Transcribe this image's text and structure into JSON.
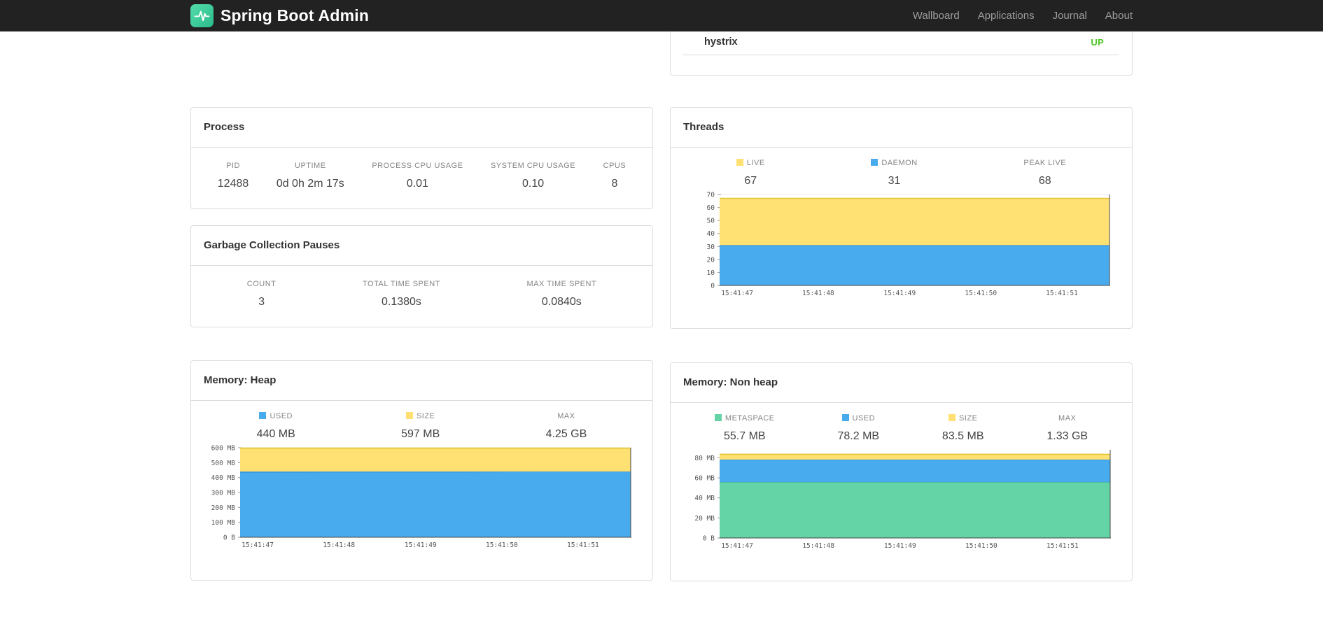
{
  "navbar": {
    "brand": "Spring Boot Admin",
    "links": [
      {
        "label": "Wallboard"
      },
      {
        "label": "Applications"
      },
      {
        "label": "Journal"
      },
      {
        "label": "About"
      }
    ]
  },
  "colors": {
    "status_up": "#46c41c",
    "blue": "#48abee",
    "blue_edge": "#2f8fd4",
    "yellow": "#ffe173",
    "yellow_edge": "#e2c338",
    "green": "#64d3a5",
    "green_edge": "#3fbd8a"
  },
  "health": {
    "service": "hystrix",
    "status": "UP"
  },
  "process": {
    "title": "Process",
    "metrics": [
      {
        "label": "PID",
        "value": "12488"
      },
      {
        "label": "UPTIME",
        "value": "0d 0h 2m 17s"
      },
      {
        "label": "PROCESS CPU USAGE",
        "value": "0.01"
      },
      {
        "label": "SYSTEM CPU USAGE",
        "value": "0.10"
      },
      {
        "label": "CPUS",
        "value": "8"
      }
    ]
  },
  "gc": {
    "title": "Garbage Collection Pauses",
    "metrics": [
      {
        "label": "COUNT",
        "value": "3"
      },
      {
        "label": "TOTAL TIME SPENT",
        "value": "0.1380s"
      },
      {
        "label": "MAX TIME SPENT",
        "value": "0.0840s"
      }
    ]
  },
  "threads": {
    "title": "Threads",
    "legend": [
      {
        "label": "LIVE",
        "value": "67",
        "color": "#ffe173"
      },
      {
        "label": "DAEMON",
        "value": "31",
        "color": "#48abee"
      },
      {
        "label": "PEAK LIVE",
        "value": "68"
      }
    ]
  },
  "heap": {
    "title": "Memory: Heap",
    "legend": [
      {
        "label": "USED",
        "value": "440 MB",
        "color": "#48abee"
      },
      {
        "label": "SIZE",
        "value": "597 MB",
        "color": "#ffe173"
      },
      {
        "label": "MAX",
        "value": "4.25 GB"
      }
    ]
  },
  "nonheap": {
    "title": "Memory: Non heap",
    "legend": [
      {
        "label": "METASPACE",
        "value": "55.7 MB",
        "color": "#64d3a5"
      },
      {
        "label": "USED",
        "value": "78.2 MB",
        "color": "#48abee"
      },
      {
        "label": "SIZE",
        "value": "83.5 MB",
        "color": "#ffe173"
      },
      {
        "label": "MAX",
        "value": "1.33 GB"
      }
    ]
  },
  "chart_data": [
    {
      "id": "threads",
      "type": "area",
      "stacked": true,
      "title": "Threads",
      "x": [
        "15:41:47",
        "15:41:48",
        "15:41:49",
        "15:41:50",
        "15:41:51"
      ],
      "ylim": [
        0,
        70
      ],
      "yticks": [
        {
          "v": 0,
          "label": "0"
        },
        {
          "v": 10,
          "label": "10"
        },
        {
          "v": 20,
          "label": "20"
        },
        {
          "v": 30,
          "label": "30"
        },
        {
          "v": 40,
          "label": "40"
        },
        {
          "v": 50,
          "label": "50"
        },
        {
          "v": 60,
          "label": "60"
        },
        {
          "v": 70,
          "label": "70"
        }
      ],
      "series": [
        {
          "name": "DAEMON",
          "fill": "#48abee",
          "edge": "#2f8fd4",
          "values": [
            31,
            31,
            31,
            31,
            31
          ]
        },
        {
          "name": "LIVE",
          "fill": "#ffe173",
          "edge": "#e2c338",
          "values": [
            67,
            67,
            67,
            67,
            67
          ]
        }
      ]
    },
    {
      "id": "heap",
      "type": "area",
      "stacked": true,
      "title": "Memory: Heap (MB)",
      "x": [
        "15:41:47",
        "15:41:48",
        "15:41:49",
        "15:41:50",
        "15:41:51"
      ],
      "ylim": [
        0,
        600
      ],
      "yticks": [
        {
          "v": 0,
          "label": "0 B"
        },
        {
          "v": 100,
          "label": "100 MB"
        },
        {
          "v": 200,
          "label": "200 MB"
        },
        {
          "v": 300,
          "label": "300 MB"
        },
        {
          "v": 400,
          "label": "400 MB"
        },
        {
          "v": 500,
          "label": "500 MB"
        },
        {
          "v": 600,
          "label": "600 MB"
        }
      ],
      "series": [
        {
          "name": "USED",
          "fill": "#48abee",
          "edge": "#2f8fd4",
          "values": [
            437,
            438,
            438,
            440,
            440
          ]
        },
        {
          "name": "SIZE",
          "fill": "#ffe173",
          "edge": "#e2c338",
          "values": [
            597,
            597,
            597,
            597,
            597
          ]
        }
      ]
    },
    {
      "id": "nonheap",
      "type": "area",
      "stacked": true,
      "title": "Memory: Non heap (MB)",
      "x": [
        "15:41:47",
        "15:41:48",
        "15:41:49",
        "15:41:50",
        "15:41:51"
      ],
      "ylim": [
        0,
        88
      ],
      "yticks": [
        {
          "v": 0,
          "label": "0 B"
        },
        {
          "v": 20,
          "label": "20 MB"
        },
        {
          "v": 40,
          "label": "40 MB"
        },
        {
          "v": 60,
          "label": "60 MB"
        },
        {
          "v": 80,
          "label": "80 MB"
        }
      ],
      "series": [
        {
          "name": "METASPACE",
          "fill": "#64d3a5",
          "edge": "#3fbd8a",
          "values": [
            55.7,
            55.7,
            55.7,
            55.7,
            55.7
          ]
        },
        {
          "name": "USED",
          "fill": "#48abee",
          "edge": "#2f8fd4",
          "values": [
            78.2,
            78.2,
            78.2,
            78.2,
            78.2
          ]
        },
        {
          "name": "SIZE",
          "fill": "#ffe173",
          "edge": "#e2c338",
          "values": [
            83.5,
            83.5,
            83.5,
            83.5,
            83.5
          ]
        }
      ]
    }
  ]
}
